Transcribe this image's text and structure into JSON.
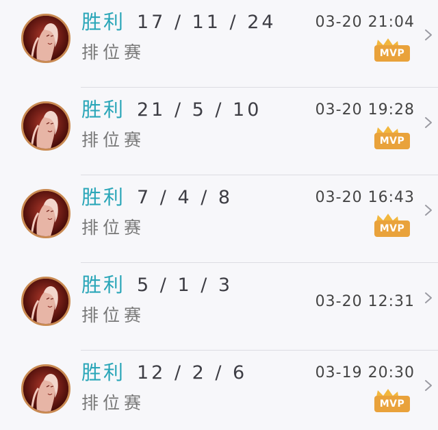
{
  "matches": [
    {
      "result": "胜利",
      "kda": "17 / 11 / 24",
      "mode": "排位赛",
      "time": "03-20 21:04",
      "mvp": true,
      "mvp_label": "MVP",
      "avatar_icon": "hero-portrait-icon",
      "arrow_icon": "chevron-right-icon"
    },
    {
      "result": "胜利",
      "kda": "21 / 5 / 10",
      "mode": "排位赛",
      "time": "03-20 19:28",
      "mvp": true,
      "mvp_label": "MVP",
      "avatar_icon": "hero-portrait-icon",
      "arrow_icon": "chevron-right-icon"
    },
    {
      "result": "胜利",
      "kda": "7 / 4 / 8",
      "mode": "排位赛",
      "time": "03-20 16:43",
      "mvp": true,
      "mvp_label": "MVP",
      "avatar_icon": "hero-portrait-icon",
      "arrow_icon": "chevron-right-icon"
    },
    {
      "result": "胜利",
      "kda": "5 / 1 / 3",
      "mode": "排位赛",
      "time": "03-20 12:31",
      "mvp": false,
      "mvp_label": "",
      "avatar_icon": "hero-portrait-icon",
      "arrow_icon": "chevron-right-icon"
    },
    {
      "result": "胜利",
      "kda": "12 / 2 / 6",
      "mode": "排位赛",
      "time": "03-19 20:30",
      "mvp": true,
      "mvp_label": "MVP",
      "avatar_icon": "hero-portrait-icon",
      "arrow_icon": "chevron-right-icon"
    }
  ],
  "colors": {
    "result": "#2aa6b8",
    "mvp_badge": "#e9a23b",
    "avatar_border": "#c98a52",
    "divider": "#dcdce2",
    "background": "#f7f7fa"
  }
}
